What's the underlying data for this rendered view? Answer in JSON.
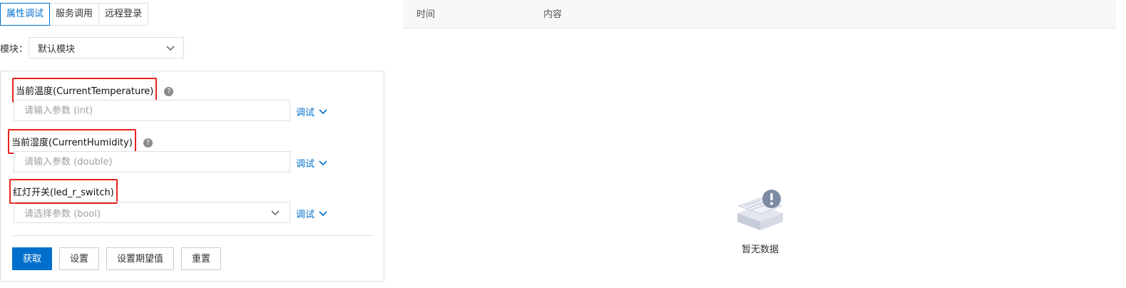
{
  "tabs": [
    {
      "label": "属性调试",
      "active": true
    },
    {
      "label": "服务调用",
      "active": false
    },
    {
      "label": "远程登录",
      "active": false
    }
  ],
  "module": {
    "label": "模块：",
    "value": "默认模块"
  },
  "properties": [
    {
      "label": "当前温度(CurrentTemperature)",
      "placeholder": "请输入参数 (int)",
      "debug": "调试",
      "has_help": true,
      "type": "input"
    },
    {
      "label": "当前湿度(CurrentHumidity)",
      "placeholder": "请输入参数 (double)",
      "debug": "调试",
      "has_help": true,
      "type": "input"
    },
    {
      "label": "红灯开关(led_r_switch)",
      "placeholder": "请选择参数 (bool)",
      "debug": "调试",
      "has_help": false,
      "type": "select"
    }
  ],
  "buttons": {
    "get": "获取",
    "set": "设置",
    "set_expected": "设置期望值",
    "reset": "重置"
  },
  "log_table": {
    "columns": [
      "时间",
      "内容"
    ],
    "empty_text": "暂无数据"
  },
  "colors": {
    "accent": "#0070cc",
    "highlight": "#e8241e",
    "border": "#dcdfe6"
  }
}
